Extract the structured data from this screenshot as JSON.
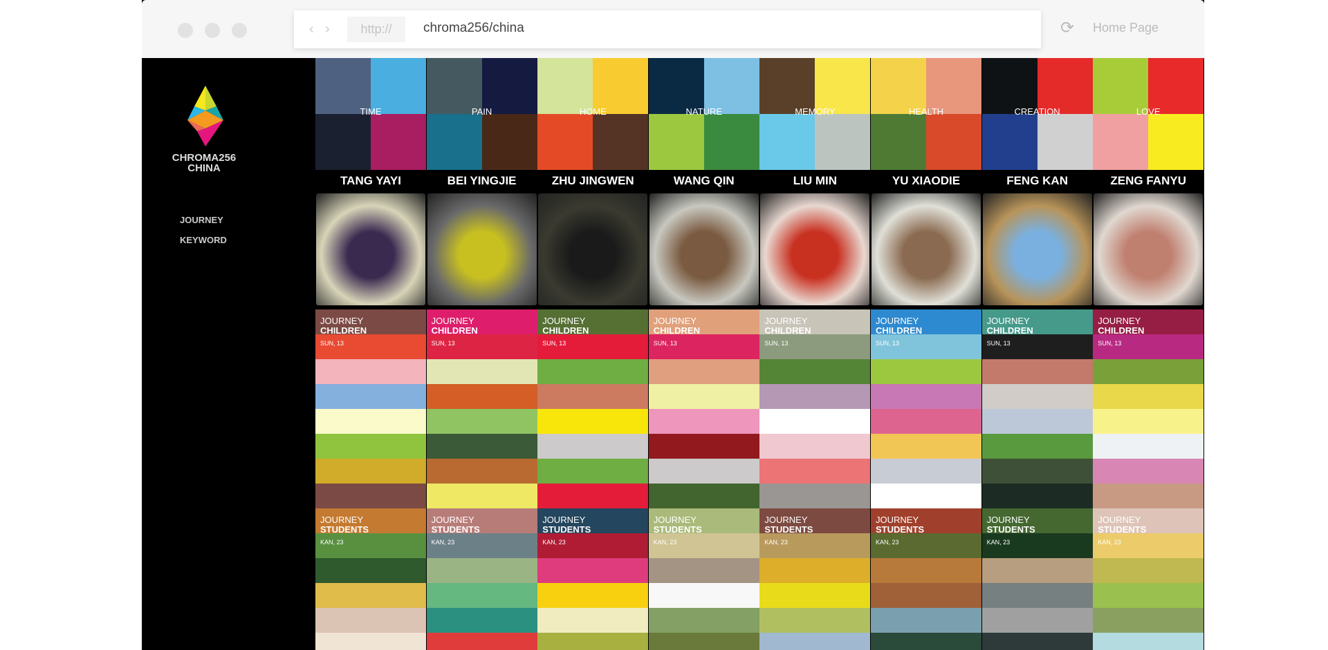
{
  "browser": {
    "protocol": "http://",
    "url": "chroma256/china",
    "home": "Home Page"
  },
  "sidebar": {
    "brand": "CHROMA256",
    "sub": "CHINA",
    "menu": [
      "JOURNEY",
      "KEYWORD"
    ]
  },
  "columns": [
    {
      "keyword": "TIME",
      "name": "TANG YAYI",
      "kw_colors": [
        "#4f6180",
        "#4aaee0",
        "#1b2030",
        "#a81e60"
      ],
      "photo": [
        "#d8d4b8",
        "#3a2a50"
      ],
      "journeys": [
        {
          "label": "JOURNEY",
          "group": "CHILDREN",
          "date": "SUN, 13",
          "colors": [
            "#7c4a44",
            "#e84a32",
            "#f4b4bc",
            "#84b0de",
            "#fafaca",
            "#90c43e",
            "#d0ac2a",
            "#7c4a44"
          ]
        },
        {
          "label": "JOURNEY",
          "group": "STUDENTS",
          "date": "KAN, 23",
          "colors": [
            "#c47a30",
            "#589040",
            "#2e5a2e",
            "#e0bc4a",
            "#dcc4b4",
            "#f0e4d4"
          ]
        }
      ]
    },
    {
      "keyword": "PAIN",
      "name": "BEI YINGJIE",
      "kw_colors": [
        "#445a60",
        "#141a40",
        "#18708c",
        "#4a2818"
      ],
      "photo": [
        "#6a6a6a",
        "#c8c020"
      ],
      "journeys": [
        {
          "label": "JOURNEY",
          "group": "CHILDREN",
          "date": "SUN, 13",
          "colors": [
            "#de1e6c",
            "#de2444",
            "#e2e6b4",
            "#d45e26",
            "#90c462",
            "#3a5a38",
            "#b86a30",
            "#eee864"
          ]
        },
        {
          "label": "JOURNEY",
          "group": "STUDENTS",
          "date": "KAN, 23",
          "colors": [
            "#b87c78",
            "#6c8088",
            "#9ab484",
            "#64b880",
            "#2c9080",
            "#e03c3c"
          ]
        }
      ]
    },
    {
      "keyword": "HOME",
      "name": "ZHU JINGWEN",
      "kw_colors": [
        "#d4e49a",
        "#f8cc30",
        "#e54a26",
        "#553426"
      ],
      "photo": [
        "#3a3a30",
        "#1a1a1a"
      ],
      "journeys": [
        {
          "label": "JOURNEY",
          "group": "CHILDREN",
          "date": "SUN, 13",
          "colors": [
            "#567034",
            "#e41c3a",
            "#6eae42",
            "#cc7a60",
            "#f8e60a",
            "#cccaca",
            "#6eae42",
            "#e41c3a"
          ]
        },
        {
          "label": "JOURNEY",
          "group": "STUDENTS",
          "date": "KAN, 23",
          "colors": [
            "#24465e",
            "#b01c34",
            "#de3c7c",
            "#f8d010",
            "#f0ecc0",
            "#a8b040"
          ]
        }
      ]
    },
    {
      "keyword": "NATURE",
      "name": "WANG QIN",
      "kw_colors": [
        "#0a2a44",
        "#7dc0e4",
        "#9cc840",
        "#3a8a40"
      ],
      "photo": [
        "#c8c8c0",
        "#7a5a40"
      ],
      "journeys": [
        {
          "label": "JOURNEY",
          "group": "CHILDREN",
          "date": "SUN, 13",
          "colors": [
            "#e0a07a",
            "#dc2460",
            "#e0a080",
            "#f0f0a4",
            "#ee96bc",
            "#921a1e",
            "#cccaca",
            "#42642e"
          ]
        },
        {
          "label": "JOURNEY",
          "group": "STUDENTS",
          "date": "KAN, 23",
          "colors": [
            "#aaba7a",
            "#d0c494",
            "#a49484",
            "#f8f8f8",
            "#84a064",
            "#6a7a3a"
          ]
        }
      ]
    },
    {
      "keyword": "MEMORY",
      "name": "LIU MIN",
      "kw_colors": [
        "#5a4028",
        "#f8e64a",
        "#6ac8e8",
        "#bcc4c0"
      ],
      "photo": [
        "#e8d8d0",
        "#c83020"
      ],
      "journeys": [
        {
          "label": "JOURNEY",
          "group": "CHILDREN",
          "date": "SUN, 13",
          "colors": [
            "#c8c4b8",
            "#8c9a7e",
            "#548436",
            "#b498b4",
            "#ffffff",
            "#f0c8d0",
            "#ec7474",
            "#9a9694"
          ]
        },
        {
          "label": "JOURNEY",
          "group": "STUDENTS",
          "date": "KAN, 23",
          "colors": [
            "#7c4a40",
            "#b89a5c",
            "#dcae2a",
            "#e8dc1a",
            "#b0c060",
            "#a0b8d0"
          ]
        }
      ]
    },
    {
      "keyword": "HEALTH",
      "name": "YU XIAODIE",
      "kw_colors": [
        "#f4d24a",
        "#e8967c",
        "#4e7a34",
        "#d84a2a"
      ],
      "photo": [
        "#e0e0d8",
        "#8a6a50"
      ],
      "journeys": [
        {
          "label": "JOURNEY",
          "group": "CHILDREN",
          "date": "SUN, 13",
          "colors": [
            "#2e8ad0",
            "#80c4dc",
            "#9cc840",
            "#c878b4",
            "#de6490",
            "#f2c654",
            "#c8ccd4",
            "#ffffff"
          ]
        },
        {
          "label": "JOURNEY",
          "group": "STUDENTS",
          "date": "KAN, 23",
          "colors": [
            "#a0402c",
            "#5a6a30",
            "#b87a3a",
            "#a06038",
            "#7aa0b0",
            "#2a4a3a"
          ]
        }
      ]
    },
    {
      "keyword": "CREATION",
      "name": "FENG KAN",
      "kw_colors": [
        "#0e1214",
        "#e52a2a",
        "#213f8c",
        "#d0d0d0"
      ],
      "photo": [
        "#b8945a",
        "#7ab0e0"
      ],
      "journeys": [
        {
          "label": "JOURNEY",
          "group": "CHILDREN",
          "date": "SUN, 13",
          "colors": [
            "#459a8a",
            "#1e1e1e",
            "#c47a6a",
            "#d2ccc8",
            "#bcc8d8",
            "#5a9a3e",
            "#3e5038",
            "#1c2c24"
          ]
        },
        {
          "label": "JOURNEY",
          "group": "STUDENTS",
          "date": "KAN, 23",
          "colors": [
            "#446830",
            "#1a3a20",
            "#b89e80",
            "#768080",
            "#a0a0a0",
            "#2e3a3a"
          ]
        }
      ]
    },
    {
      "keyword": "LOVE",
      "name": "ZENG FANYU",
      "kw_colors": [
        "#a8cc38",
        "#e82a2a",
        "#f0a0a0",
        "#f8ec20"
      ],
      "photo": [
        "#e0d8d0",
        "#c08070"
      ],
      "journeys": [
        {
          "label": "JOURNEY",
          "group": "CHILDREN",
          "date": "SUN, 13",
          "colors": [
            "#961e44",
            "#b82a82",
            "#7aa03a",
            "#e8d84a",
            "#f8f28a",
            "#eef2f4",
            "#d886b4",
            "#c89a84"
          ]
        },
        {
          "label": "JOURNEY",
          "group": "STUDENTS",
          "date": "KAN, 23",
          "colors": [
            "#dec4b8",
            "#eccc6a",
            "#c0b850",
            "#9ac050",
            "#8aa060",
            "#b4dce0"
          ]
        }
      ]
    }
  ]
}
